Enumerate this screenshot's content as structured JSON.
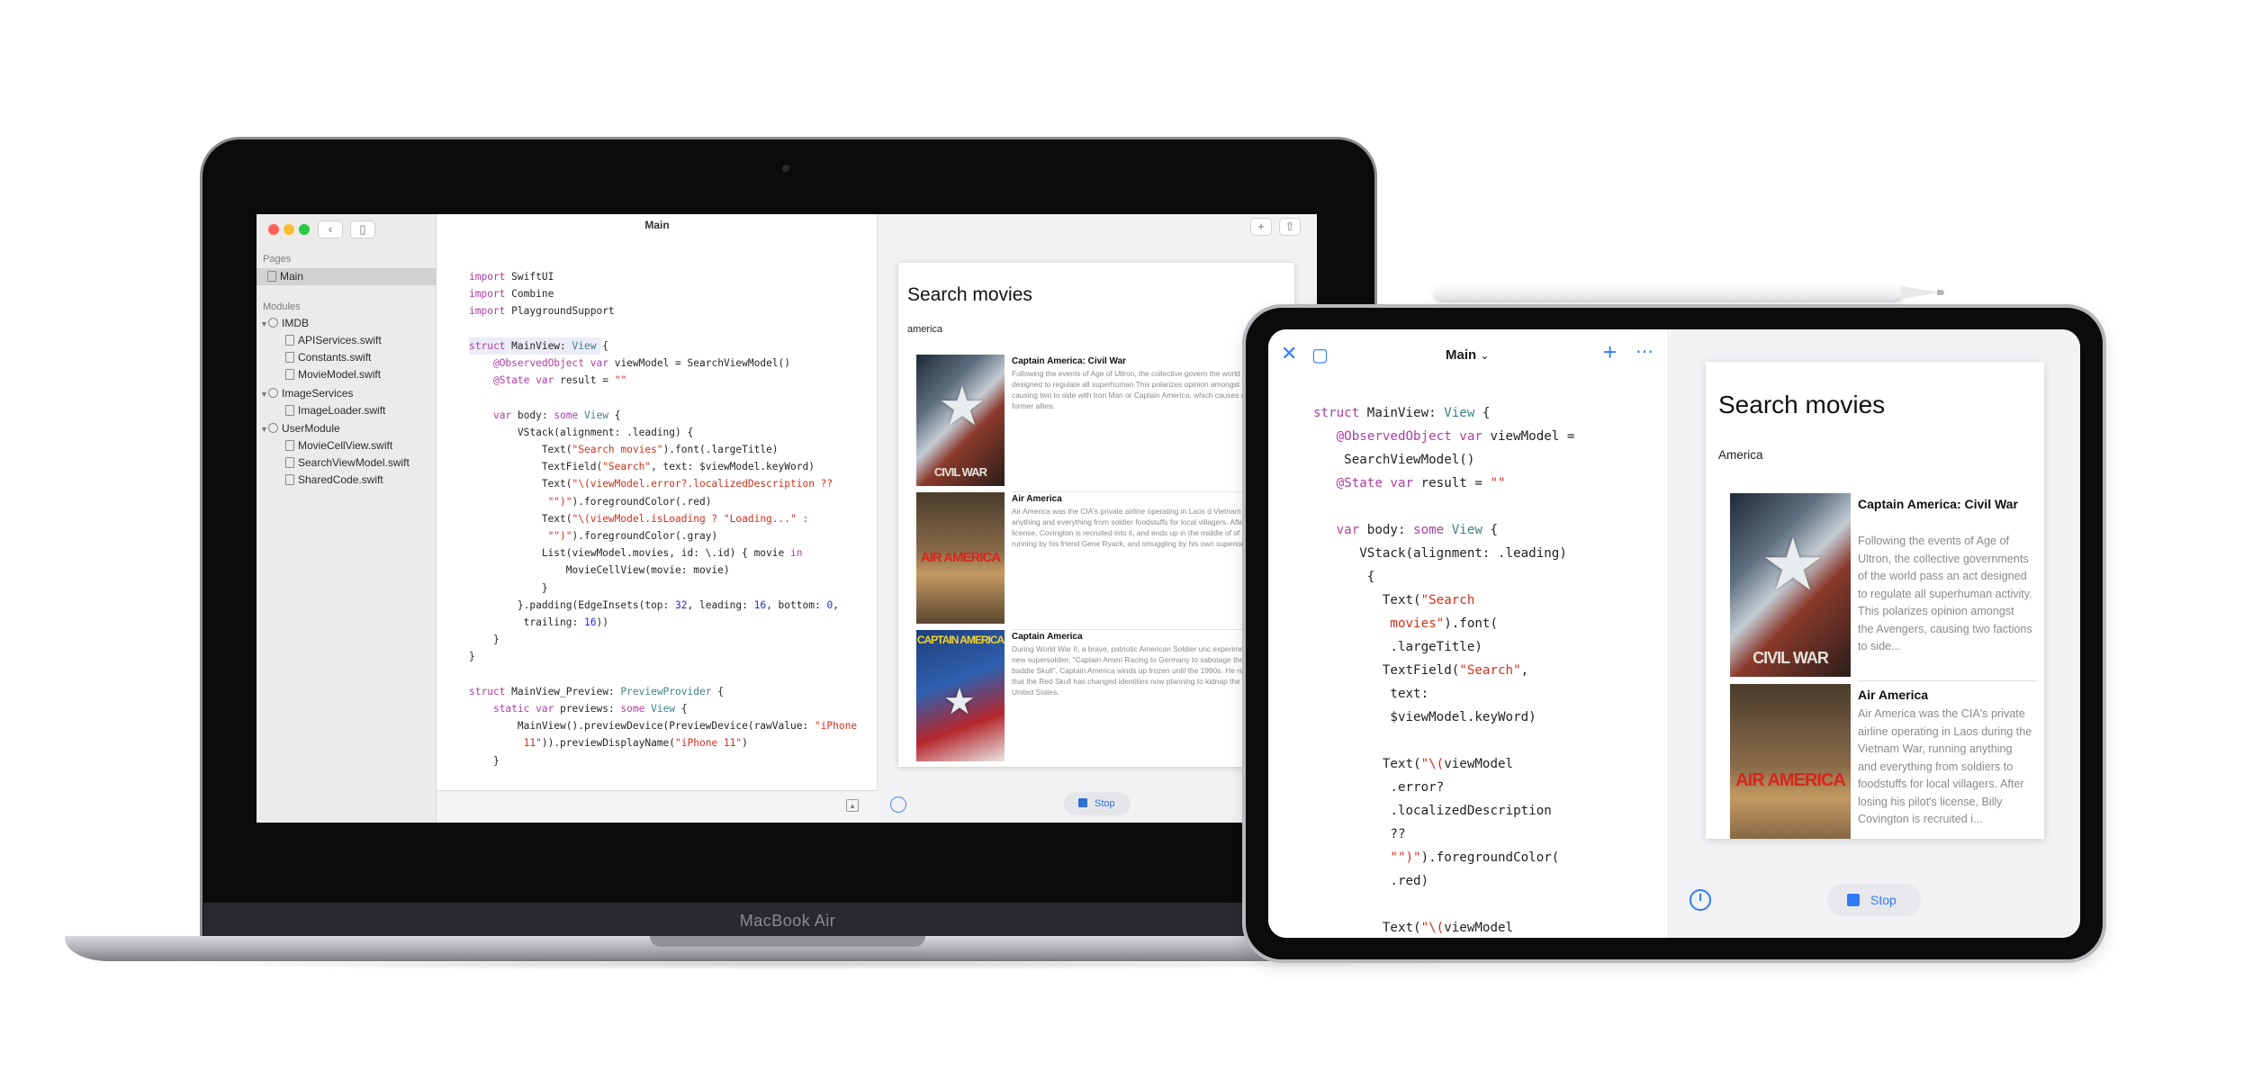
{
  "macbook": {
    "brand": "MacBook Air",
    "window": {
      "title": "Main",
      "sidebar": {
        "pages_header": "Pages",
        "pages": [
          "Main"
        ],
        "modules_header": "Modules",
        "modules": [
          {
            "name": "IMDB",
            "files": [
              "APIServices.swift",
              "Constants.swift",
              "MovieModel.swift"
            ]
          },
          {
            "name": "ImageServices",
            "files": [
              "ImageLoader.swift"
            ]
          },
          {
            "name": "UserModule",
            "files": [
              "MovieCellView.swift",
              "SearchViewModel.swift",
              "SharedCode.swift"
            ]
          }
        ]
      },
      "stop_label": "Stop"
    },
    "preview": {
      "title": "Search movies",
      "search_value": "america",
      "movies": [
        {
          "title": "Captain America: Civil War",
          "description": "Following the events of Age of Ultron, the collective govern the world pass an act designed to regulate all superhuman This polarizes opinion amongst the Avengers, causing two to side with Iron Man or Captain America, which causes an battle between former allies.",
          "poster_text": "CIVIL WAR"
        },
        {
          "title": "Air America",
          "description": "Air America was the CIA's private airline operating in Laos d Vietnam War, running anything and everything from soldier foodstuffs for local villagers. After losing his pilot's license, Covington is recruited into it, and ends up in the middle of of lunatic pilots, gun-running by his friend Gene Ryack, and smuggling by his own superiors.",
          "poster_text": "AIR AMERICA"
        },
        {
          "title": "Captain America",
          "description": "During World War II, a brave, patriotic American Soldier unc experiments to become a new supersoldier, \"Captain Ameri Racing to Germany to sabotage the rockets of Nazi baddie Skull\", Captain America winds up frozen until the 1990s. He reawakens to find that the Red Skull has changed identities now planning to kidnap the President of the United States.",
          "poster_text": "CAPTAIN AMERICA"
        }
      ]
    }
  },
  "ipad": {
    "title": "Main",
    "stop_label": "Stop",
    "preview": {
      "title": "Search movies",
      "search_value": "America",
      "movies": [
        {
          "title": "Captain America: Civil War",
          "description": "Following the events of Age of Ultron, the collective governments of the world pass an act designed to regulate all superhuman activity. This polarizes opinion amongst the Avengers, causing two factions to side...",
          "poster_text": "CIVIL WAR"
        },
        {
          "title": "Air America",
          "description": "Air America was the CIA's private airline operating in Laos during the Vietnam War, running anything and everything from soldiers to foodstuffs for local villagers. After losing his pilot's license, Billy Covington is recruited i...",
          "poster_text": "AIR AMERICA"
        }
      ]
    }
  },
  "colors": {
    "accent": "#2f7bf6",
    "keyword": "#ad3da4",
    "string": "#d12f1b",
    "number": "#272ad8",
    "type": "#3e8087"
  }
}
